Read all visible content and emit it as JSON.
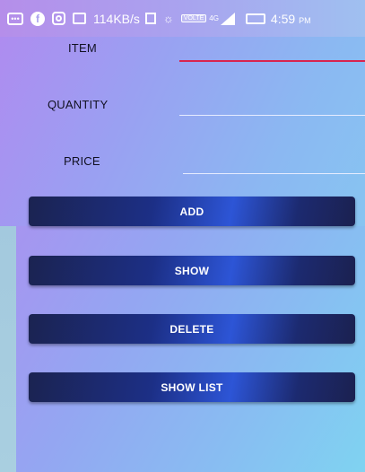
{
  "status_bar": {
    "speed": "114KB/s",
    "volte": "VOLTE",
    "network": "4G",
    "time": "4:59",
    "ampm": "PM",
    "icons": [
      "more-icon",
      "facebook-icon",
      "instagram-icon",
      "message-icon",
      "square-icon",
      "sun-icon",
      "volte-icon",
      "signal-icon",
      "battery-icon"
    ]
  },
  "form": {
    "item_label": "ITEM",
    "quantity_label": "QUANTITY",
    "price_label": "PRICE",
    "item_value": "",
    "quantity_value": "",
    "price_value": ""
  },
  "buttons": {
    "add": "ADD",
    "show": "SHOW",
    "delete": "DELETE",
    "show_list": "SHOW LIST"
  },
  "colors": {
    "button_dark": "#1b2351",
    "button_highlight": "#2d55d6",
    "focus_underline": "#d8244f"
  }
}
